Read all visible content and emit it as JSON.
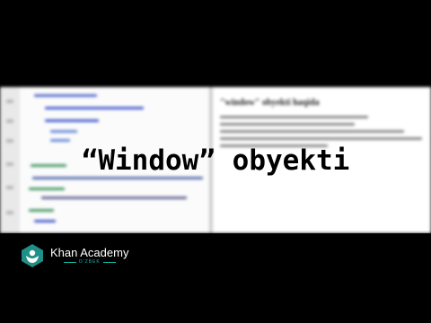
{
  "video": {
    "title_overlay": "“Window” obyekti",
    "preview_heading": "\"window\" obyekti haqida",
    "brand_name": "Khan Academy",
    "brand_sub": "O'ZBEK"
  },
  "colors": {
    "background": "#000000",
    "editor_bg": "#fbfbfb",
    "preview_bg": "#ffffff",
    "brand_text": "#ffffff",
    "brand_accent": "#16b7a6",
    "logo_badge": "#1f8f87"
  },
  "icons": {
    "logo": "khan-academy-leaf-hexagon-icon"
  }
}
